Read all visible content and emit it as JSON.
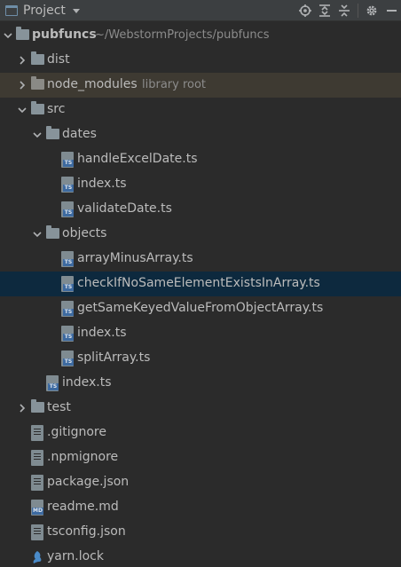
{
  "toolbar": {
    "title": "Project",
    "icons": [
      "locate-icon",
      "expand-all-icon",
      "collapse-all-icon",
      "gear-icon",
      "minimize-icon"
    ]
  },
  "tree": {
    "root": {
      "name": "pubfuncs",
      "path": "~/WebstormProjects/pubfuncs"
    },
    "dist": {
      "name": "dist"
    },
    "node_modules": {
      "name": "node_modules",
      "hint": "library root"
    },
    "src": {
      "name": "src"
    },
    "dates": {
      "name": "dates",
      "files": [
        "handleExcelDate.ts",
        "index.ts",
        "validateDate.ts"
      ]
    },
    "objects": {
      "name": "objects",
      "files": [
        "arrayMinusArray.ts",
        "checkIfNoSameElementExistsInArray.ts",
        "getSameKeyedValueFromObjectArray.ts",
        "index.ts",
        "splitArray.ts"
      ]
    },
    "src_index": {
      "name": "index.ts"
    },
    "test": {
      "name": "test"
    },
    "root_files": [
      ".gitignore",
      ".npmignore",
      "package.json",
      "readme.md",
      "tsconfig.json",
      "yarn.lock"
    ],
    "selected": "checkIfNoSameElementExistsInArray.ts"
  },
  "colors": {
    "background": "#2b2b2b",
    "toolbar": "#3c3f41",
    "selection": "#0d293e",
    "excluded_row": "#3e3a32",
    "ts_badge": "#3d6aa0"
  }
}
